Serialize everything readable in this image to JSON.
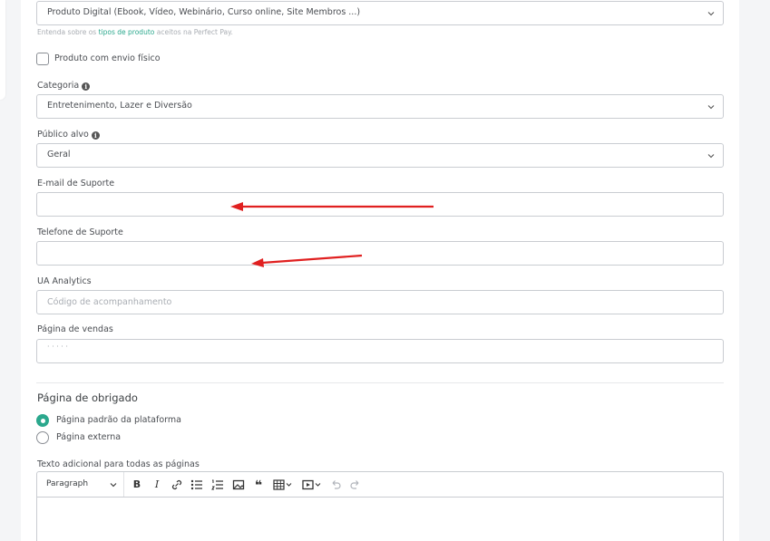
{
  "product_type": {
    "value": "Produto Digital (Ebook, Vídeo, Webinário, Curso online, Site Membros ...)",
    "help_prefix": "Entenda sobre os ",
    "help_link": "tipos de produto",
    "help_suffix": " aceitos na Perfect Pay."
  },
  "physical_shipping": {
    "label": "Produto com envio físico",
    "checked": false
  },
  "category": {
    "label": "Categoria",
    "value": "Entretenimento, Lazer e Diversão"
  },
  "audience": {
    "label": "Público alvo",
    "value": "Geral"
  },
  "support_email": {
    "label": "E-mail de Suporte",
    "value": ""
  },
  "support_phone": {
    "label": "Telefone de Suporte",
    "value": ""
  },
  "ua_analytics": {
    "label": "UA Analytics",
    "placeholder": "Código de acompanhamento"
  },
  "sales_page": {
    "label": "Página de vendas",
    "value": "· · · ·  ·"
  },
  "thank_you_page": {
    "title": "Página de obrigado",
    "options": [
      {
        "label": "Página padrão da plataforma",
        "selected": true
      },
      {
        "label": "Página externa",
        "selected": false
      }
    ]
  },
  "extra_text": {
    "label": "Texto adicional para todas as páginas",
    "format_select": "Paragraph"
  },
  "colors": {
    "accent": "#2ba88d",
    "annotation_arrow": "#e02020"
  }
}
